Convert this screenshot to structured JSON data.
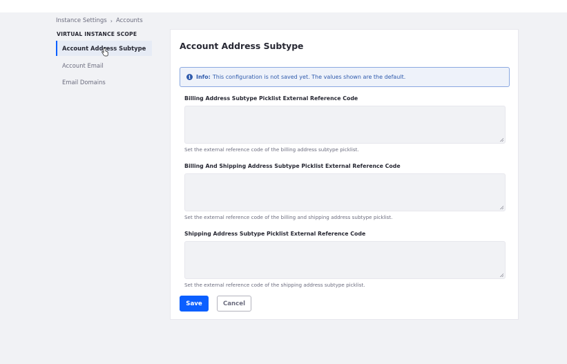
{
  "breadcrumb": {
    "items": [
      "Instance Settings",
      "Accounts"
    ],
    "separator": "›"
  },
  "sidebar": {
    "scope_title": "VIRTUAL INSTANCE SCOPE",
    "items": [
      {
        "label": "Account Address Subtype",
        "active": true
      },
      {
        "label": "Account Email",
        "active": false
      },
      {
        "label": "Email Domains",
        "active": false
      }
    ]
  },
  "main": {
    "title": "Account Address Subtype",
    "info": {
      "label": "Info:",
      "message": "This configuration is not saved yet. The values shown are the default."
    },
    "fields": [
      {
        "label": "Billing Address Subtype Picklist External Reference Code",
        "value": "",
        "help": "Set the external reference code of the billing address subtype picklist."
      },
      {
        "label": "Billing And Shipping Address Subtype Picklist External Reference Code",
        "value": "",
        "help": "Set the external reference code of the billing and shipping address subtype picklist."
      },
      {
        "label": "Shipping Address Subtype Picklist External Reference Code",
        "value": "",
        "help": "Set the external reference code of the shipping address subtype picklist."
      }
    ],
    "save_label": "Save",
    "cancel_label": "Cancel"
  },
  "icons": {
    "info": "info-circle-icon",
    "cursor": "hand-pointer-icon",
    "breadcrumb_separator": "chevron-right-icon"
  },
  "colors": {
    "primary": "#0b5fff",
    "info_bg": "#eef2fa",
    "info_border": "#89a7e0",
    "info_text": "#2e5aac",
    "page_bg": "#f1f2f5",
    "nav_active_bg": "#e6ebf5"
  }
}
